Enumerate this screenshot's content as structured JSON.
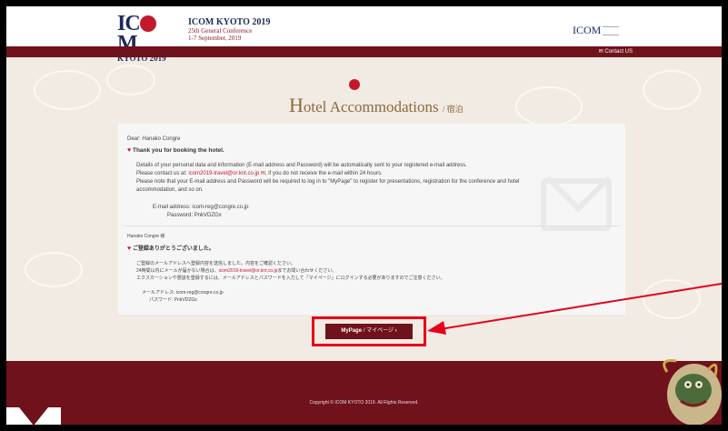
{
  "header": {
    "logo_big": "IC",
    "logo_big_tail": "M",
    "logo_small": "KYOTO 2019",
    "conf_title": "ICOM KYOTO 2019",
    "conf_sub1": "25th General Conference",
    "conf_sub2": "1-7 September, 2019",
    "right_logo": "ICOM",
    "contact": "✉ Contact US"
  },
  "page": {
    "title_cap": "H",
    "title_rest": "otel Accommodations",
    "title_jp": "/ 宿泊"
  },
  "card": {
    "greeting": "Dear: Hanako Congre",
    "thanks": "Thank you for booking the hotel.",
    "p1": "Details of your personal data and information (E-mail address and Password) will be automatically sent to your registered e-mail address.",
    "p2_pre": "Please contact us at: ",
    "p2_link": "icom2019-travel@or.knt.co.jp ✉",
    "p2_post": ", if you do not receive the e-mail within 24 hours.",
    "p3": "Please note that your E-mail address and Password will be required to log in to \"MyPage\" to register for presentations, registration for the conference and hotel",
    "p4": "accommodation, and so on.",
    "email_label": "E-mail address:",
    "email_value": "icom-reg@congre.co.jp",
    "password_label": "Password:",
    "password_value": "PnkVDZGx",
    "jp_greeting": "Hanako Congre 様",
    "jp_thanks": "ご登録ありがとうございました。",
    "jp_p1": "ご登録のメールアドレスへ登録内容を送信しました。内容をご確認ください。",
    "jp_p2_pre": "24時間以内にメールが届かない場合は、",
    "jp_p2_link": "icom2019-travel@or.knt.co.jp",
    "jp_p2_post": "までお問い合わせください。",
    "jp_p3": "エクスカーションや懇談を登録するには、メールアドレスとパスワードを入力して「マイページ」にログインする必要がありますのでご注意ください。",
    "jp_email_label": "メールアドレス:",
    "jp_email_value": "icom-reg@congre.co.jp",
    "jp_password_label": "パスワード:",
    "jp_password_value": "PnkVDZGx"
  },
  "mypage": {
    "label": "MyPage",
    "label_jp": "/ マイページ",
    "chevron": "›"
  },
  "footer": {
    "copyright": "Copyright © ICOM KYOTO 2019. All Rights Reserved."
  },
  "colors": {
    "brand_red": "#6f121b",
    "accent_red": "#c4192b",
    "highlight_red": "#e5001a"
  }
}
